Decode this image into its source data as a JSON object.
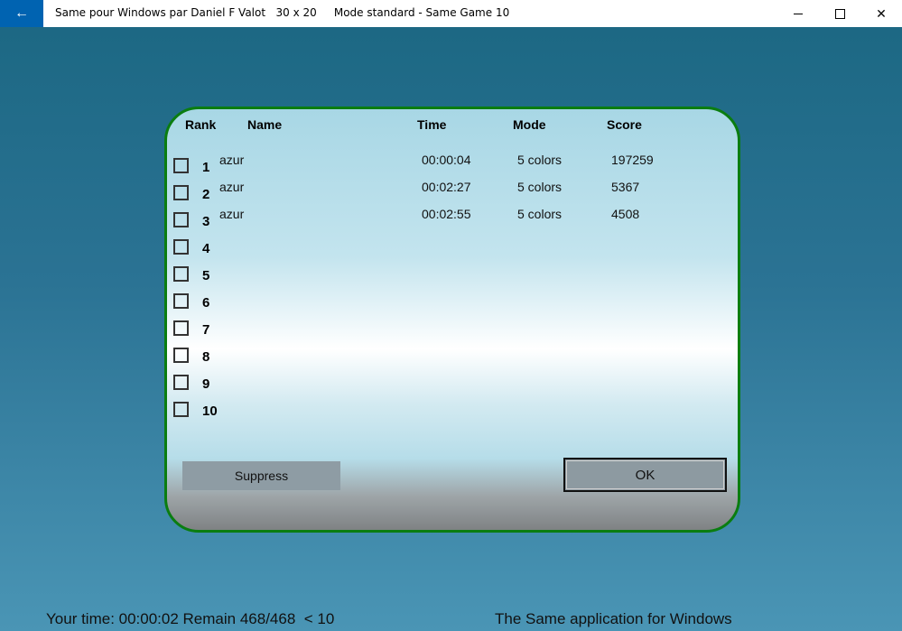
{
  "window": {
    "title": "Same pour Windows par Daniel F Valot   30 x 20     Mode standard - Same Game 10",
    "back_icon": "←",
    "min_icon": "minimize-icon",
    "max_icon": "maximize-icon",
    "close_icon": "✕"
  },
  "scores": {
    "headers": {
      "rank": "Rank",
      "name": "Name",
      "time": "Time",
      "mode": "Mode",
      "score": "Score"
    },
    "rows": [
      {
        "rank": "1",
        "name": "azur",
        "time": "00:00:04",
        "mode": "5 colors",
        "score": "197259"
      },
      {
        "rank": "2",
        "name": "azur",
        "time": "00:02:27",
        "mode": "5 colors",
        "score": "5367"
      },
      {
        "rank": "3",
        "name": "azur",
        "time": "00:02:55",
        "mode": "5 colors",
        "score": "4508"
      },
      {
        "rank": "4",
        "name": "",
        "time": "",
        "mode": "",
        "score": ""
      },
      {
        "rank": "5",
        "name": "",
        "time": "",
        "mode": "",
        "score": ""
      },
      {
        "rank": "6",
        "name": "",
        "time": "",
        "mode": "",
        "score": ""
      },
      {
        "rank": "7",
        "name": "",
        "time": "",
        "mode": "",
        "score": ""
      },
      {
        "rank": "8",
        "name": "",
        "time": "",
        "mode": "",
        "score": ""
      },
      {
        "rank": "9",
        "name": "",
        "time": "",
        "mode": "",
        "score": ""
      },
      {
        "rank": "10",
        "name": "",
        "time": "",
        "mode": "",
        "score": ""
      }
    ],
    "suppress_label": "Suppress",
    "ok_label": "OK"
  },
  "status": {
    "left": "Your time: 00:00:02 Remain 468/468  < 10",
    "right": "The Same application for Windows"
  },
  "colors": {
    "accent": "#0063b1",
    "dialog_border": "#0a7d10"
  }
}
